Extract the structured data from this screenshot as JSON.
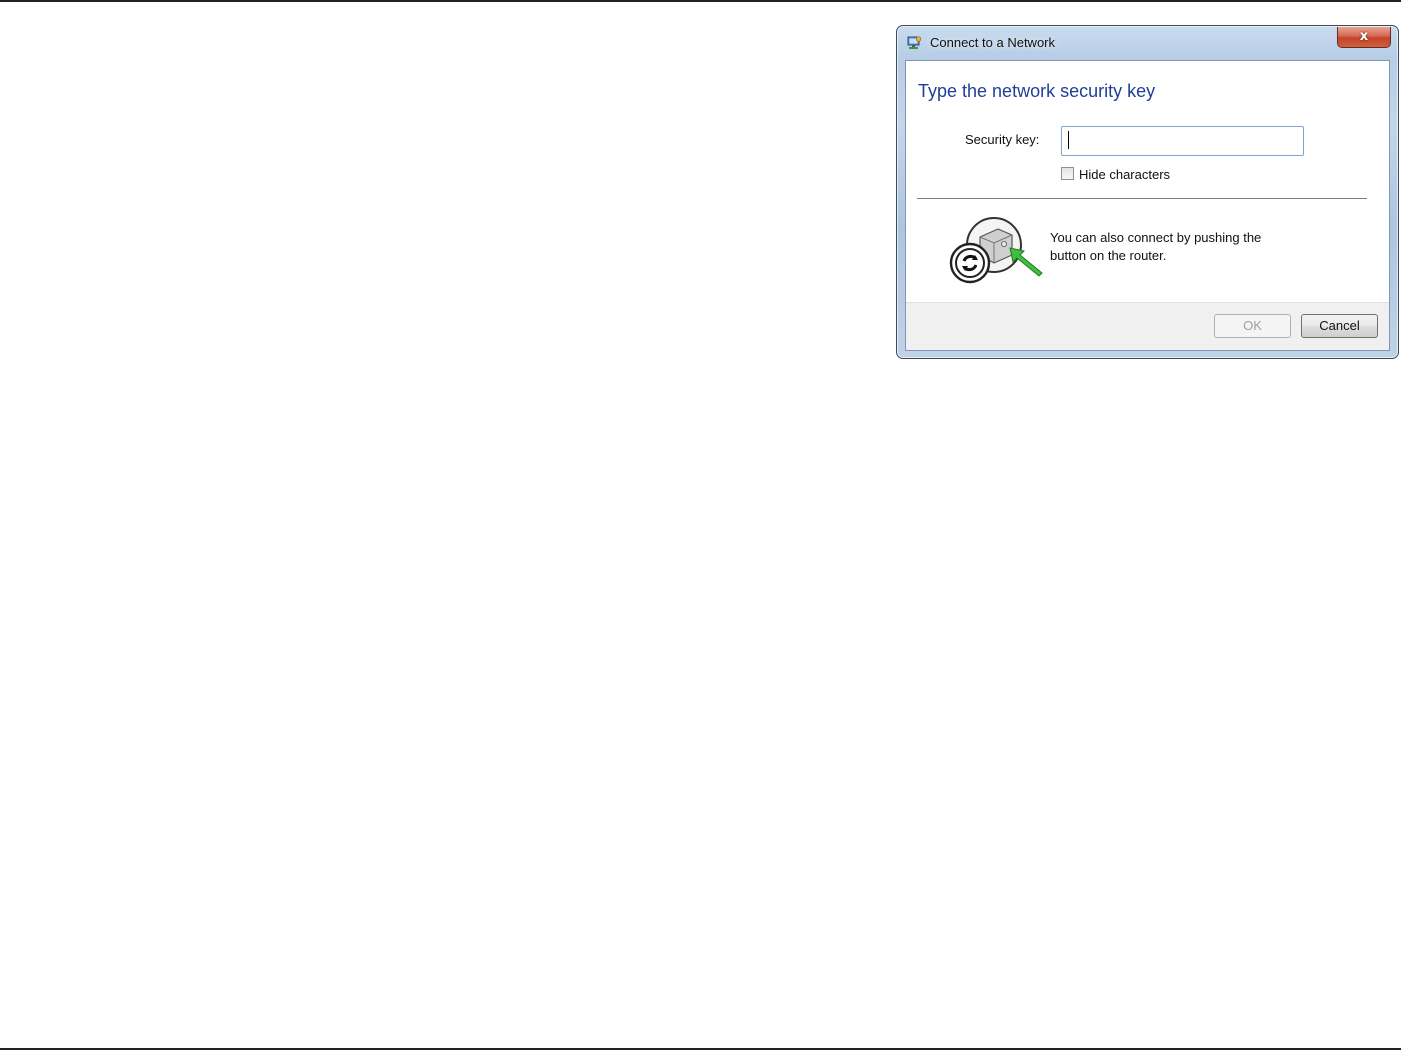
{
  "window": {
    "title": "Connect to a Network",
    "close_glyph": "x",
    "icon": "network-icon"
  },
  "dialog": {
    "heading": "Type the network security key",
    "security_key_label": "Security key:",
    "security_key_value": "",
    "hide_characters_label": "Hide characters",
    "hide_characters_checked": false,
    "router_text": "You can also connect by pushing the button on the router.",
    "router_icon": "wps-router-button-icon"
  },
  "buttons": {
    "ok_label": "OK",
    "ok_enabled": false,
    "cancel_label": "Cancel"
  },
  "colors": {
    "heading": "#1e3f96",
    "wps_arrow": "#3fbf3f"
  }
}
